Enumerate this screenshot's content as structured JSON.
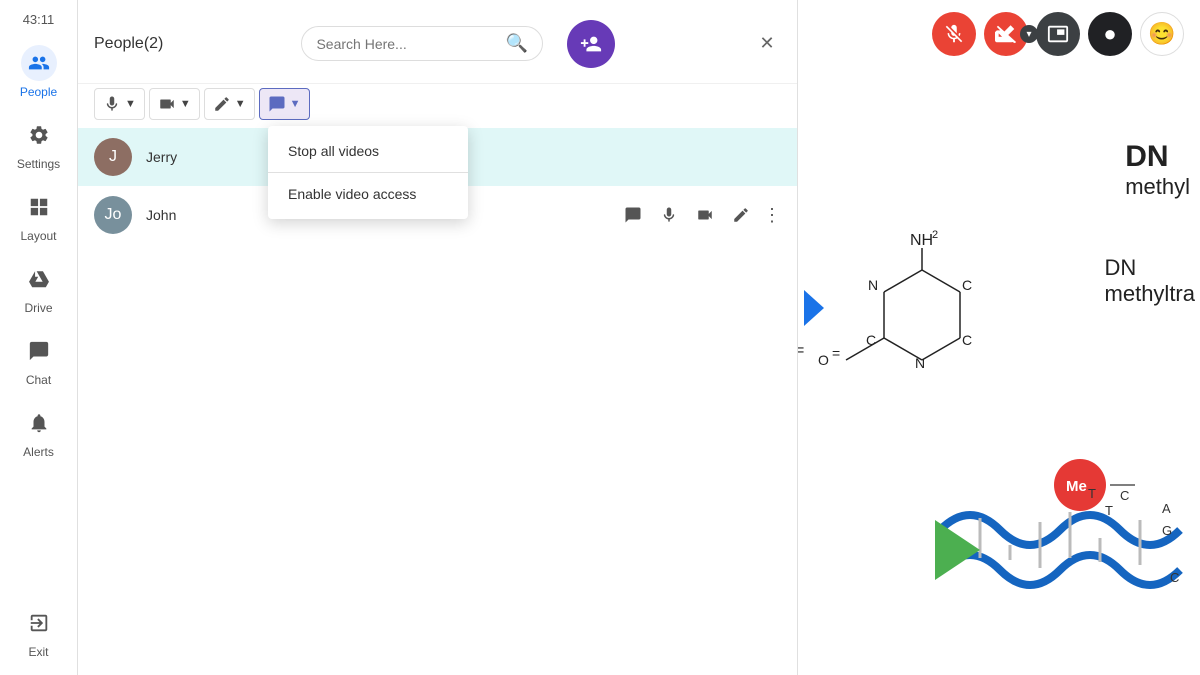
{
  "sidebar": {
    "time": "43:11",
    "items": [
      {
        "id": "people",
        "label": "People",
        "icon": "people",
        "active": true
      },
      {
        "id": "settings",
        "label": "Settings",
        "icon": "settings",
        "active": false
      },
      {
        "id": "layout",
        "label": "Layout",
        "icon": "layout",
        "active": false
      },
      {
        "id": "drive",
        "label": "Drive",
        "icon": "drive",
        "active": false
      },
      {
        "id": "chat",
        "label": "Chat",
        "icon": "chat",
        "active": false
      },
      {
        "id": "alerts",
        "label": "Alerts",
        "icon": "alerts",
        "active": false
      },
      {
        "id": "exit",
        "label": "Exit",
        "icon": "exit",
        "active": false
      }
    ]
  },
  "people_panel": {
    "title": "People(2)",
    "search_placeholder": "Search Here...",
    "add_person_title": "Add person",
    "controls": {
      "mic_label": "Mic",
      "video_label": "Video",
      "pencil_label": "Pencil",
      "chat_label": "Chat"
    },
    "dropdown": {
      "items": [
        {
          "id": "stop-all-videos",
          "label": "Stop all videos"
        },
        {
          "id": "enable-video-access",
          "label": "Enable video access"
        }
      ]
    },
    "people": [
      {
        "id": "jerry",
        "name": "Jerry",
        "highlighted": true,
        "initials": "J",
        "color": "#8d6e63"
      },
      {
        "id": "john",
        "name": "John",
        "highlighted": false,
        "initials": "Jo",
        "color": "#78909c"
      }
    ]
  },
  "top_bar": {
    "mic_muted": true,
    "cam_muted": true,
    "pip_active": false,
    "record_dot": "●",
    "emoji_icon": "😊"
  },
  "slide": {
    "title_line1": "DN",
    "title_line2": "methyl",
    "subtitle1": "DN",
    "subtitle2": "methyltra"
  }
}
